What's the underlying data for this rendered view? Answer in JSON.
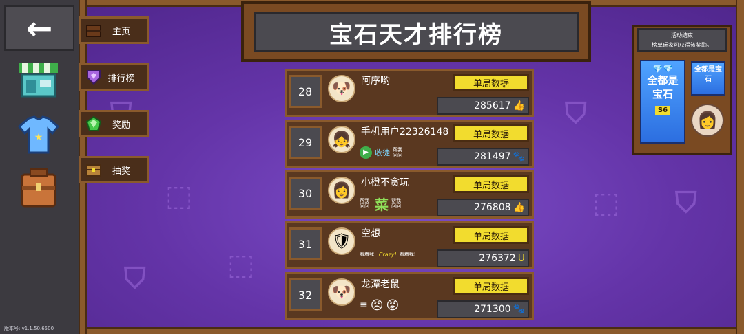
{
  "back": {
    "icon": "arrow-left-icon"
  },
  "nav_tabs": [
    {
      "label": "主页",
      "icon": "chest-icon"
    },
    {
      "label": "排行榜",
      "icon": "shield-gem-icon"
    },
    {
      "label": "奖励",
      "icon": "green-gem-icon"
    },
    {
      "label": "抽奖",
      "icon": "treasure-chest-icon"
    }
  ],
  "rail_icons": [
    "shop-icon",
    "tshirt-icon",
    "backpack-icon"
  ],
  "title": "宝石天才排行榜",
  "button_label": "单局数据",
  "ranks": [
    {
      "rank": "28",
      "name": "阿序哟",
      "score": "285617",
      "score_icon": "thumbs-up-icon",
      "badges": []
    },
    {
      "rank": "29",
      "name": "手机用户22326148",
      "score": "281497",
      "score_icon": "paw-icon",
      "badges": [
        "收徒",
        "帮我问问"
      ]
    },
    {
      "rank": "30",
      "name": "小橙不贪玩",
      "score": "276808",
      "score_icon": "thumbs-up-icon",
      "badges": [
        "帮我问问",
        "菜",
        "帮我问问"
      ]
    },
    {
      "rank": "31",
      "name": "空想",
      "score": "276372",
      "score_icon": "horseshoe-icon",
      "badges": [
        "看着我!",
        "Crazy!",
        "看着我!"
      ]
    },
    {
      "rank": "32",
      "name": "龙潭老鼠",
      "score": "271300",
      "score_icon": "paw-icon",
      "badges": []
    }
  ],
  "activity": {
    "line1": "活动结束",
    "line2": "榜单玩家可获得该奖励。",
    "poster_text": "全都是宝石",
    "poster_tag": "S6",
    "mini_text": "全都是宝石"
  },
  "version": "版本号: v1.1.50.6500"
}
